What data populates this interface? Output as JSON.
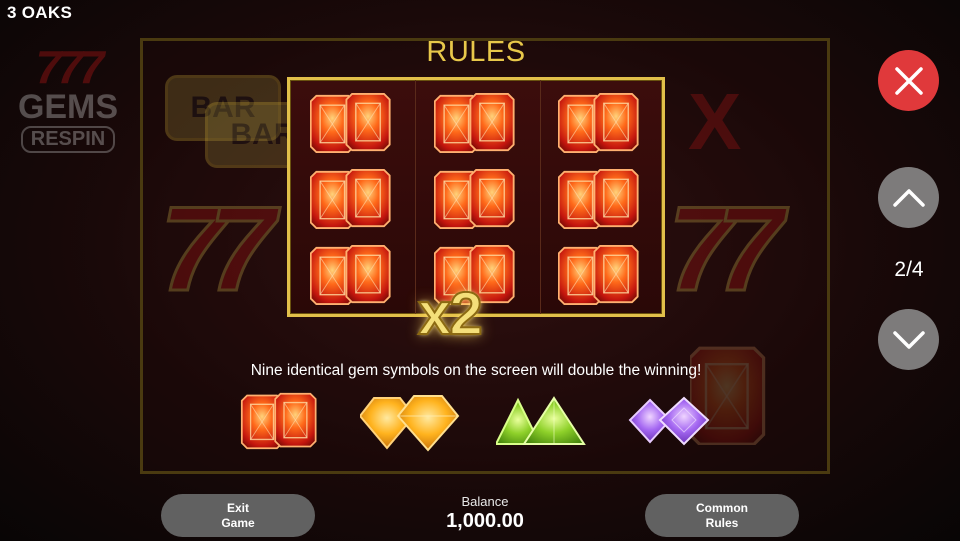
{
  "brand": "3 OAKS",
  "background_logo": {
    "sevens": "777",
    "line1": "GEMS",
    "line2": "RESPIN"
  },
  "background_symbols": {
    "bar": "BAR",
    "seven": "7",
    "x": "X"
  },
  "rules": {
    "title": "RULES",
    "multiplier": "x2",
    "description": "Nine identical gem symbols on the screen will double the winning!",
    "showcase_grid": {
      "rows": 3,
      "cols": 3,
      "symbol": "red-gem-pair"
    },
    "gem_symbols": [
      "red-gem-pair",
      "orange-gem-pair",
      "green-gem-pair",
      "purple-gem-pair"
    ]
  },
  "pager": {
    "current": 2,
    "total": 4,
    "text": "2/4"
  },
  "buttons": {
    "exit_line1": "Exit",
    "exit_line2": "Game",
    "common_line1": "Common",
    "common_line2": "Rules"
  },
  "balance": {
    "label": "Balance",
    "value": "1,000.00"
  },
  "icons": {
    "close": "close-icon",
    "up": "chevron-up-icon",
    "down": "chevron-down-icon"
  },
  "colors": {
    "accent_gold": "#e8c84a",
    "close_red": "#e0393b",
    "button_gray": "#7d7b7b"
  }
}
